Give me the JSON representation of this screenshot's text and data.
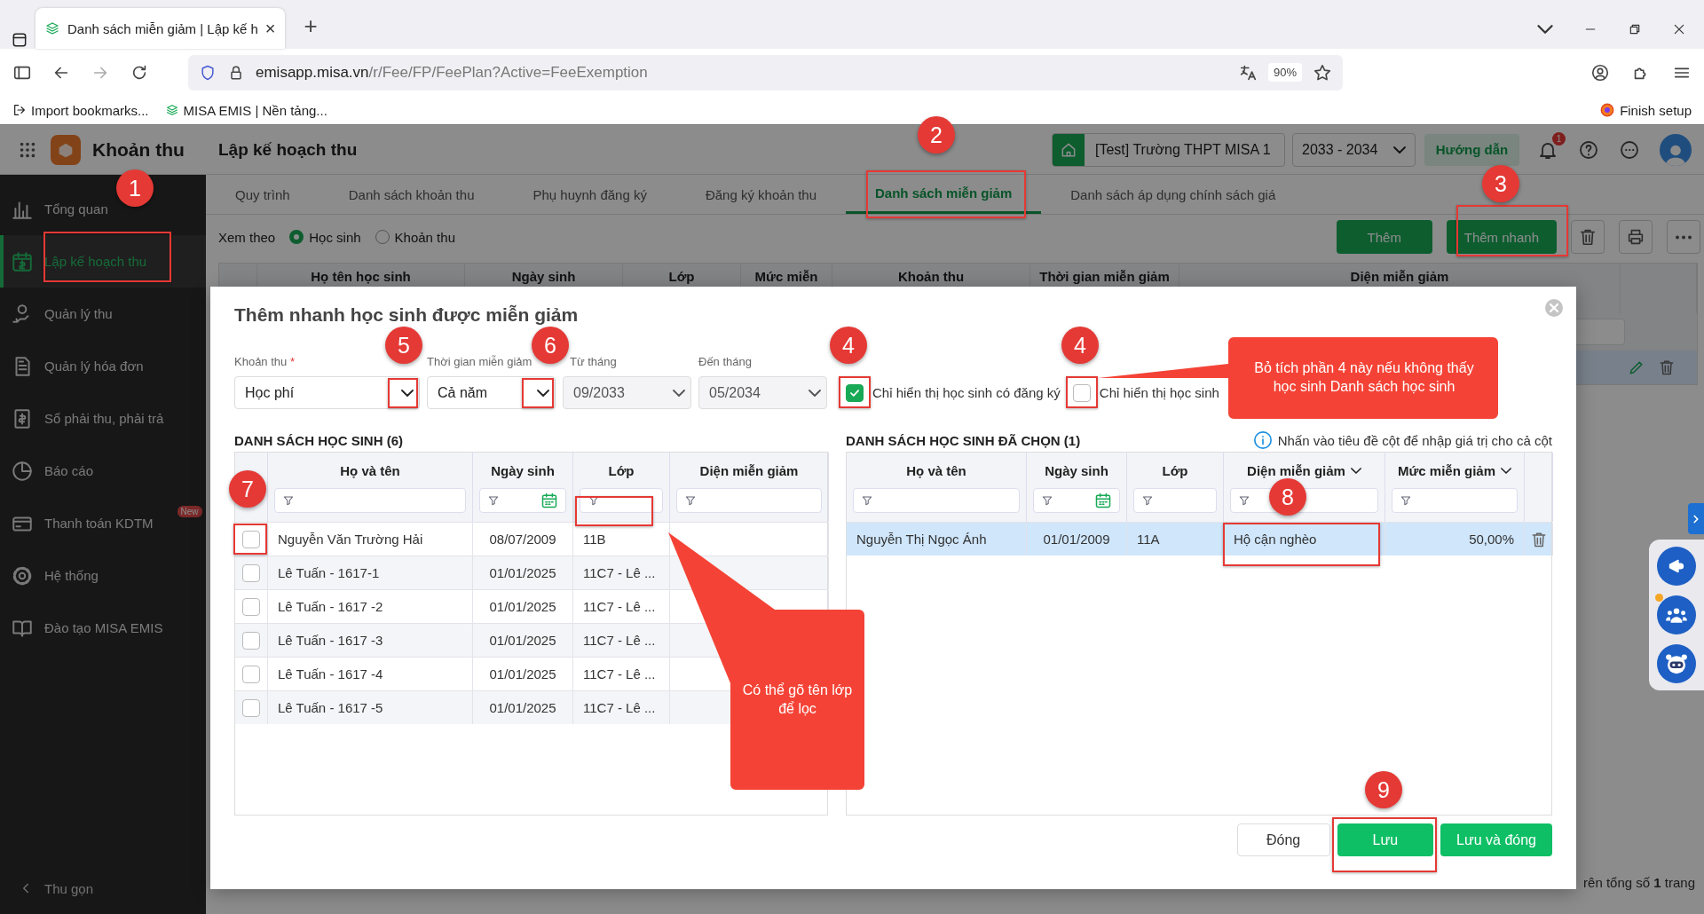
{
  "browser": {
    "tab_title": "Danh sách miễn giảm | Lập kế h",
    "tab_close": "×",
    "new_tab": "+",
    "url_host": "emisapp.misa.vn",
    "url_path": "/r/Fee/FP/FeePlan?Active=FeeExemption",
    "zoom": "90%",
    "bookmarks": [
      {
        "label": "Import bookmarks..."
      },
      {
        "label": "MISA EMIS | Nền tảng..."
      }
    ],
    "finish_setup": "Finish setup"
  },
  "app_header": {
    "app_name": "Khoản thu",
    "page_title": "Lập kế hoạch thu",
    "school": "[Test] Trường THPT MISA 1",
    "year": "2033 - 2034",
    "guide_button": "Hướng dẫn",
    "notification_count": "1"
  },
  "sidebar": {
    "items": [
      {
        "label": "Tổng quan",
        "selected": false
      },
      {
        "label": "Lập kế hoạch thu",
        "selected": true
      },
      {
        "label": "Quản lý thu",
        "selected": false
      },
      {
        "label": "Quản lý hóa đơn",
        "selected": false
      },
      {
        "label": "Sổ phải thu, phải trả",
        "selected": false
      },
      {
        "label": "Báo cáo",
        "selected": false
      },
      {
        "label": "Thanh toán KDTM",
        "selected": false,
        "badge": "New"
      },
      {
        "label": "Hệ thống",
        "selected": false
      },
      {
        "label": "Đào tạo MISA EMIS",
        "selected": false
      }
    ],
    "collapse": "Thu gọn"
  },
  "tabs": [
    {
      "label": "Quy trình",
      "selected": false
    },
    {
      "label": "Danh sách khoản thu",
      "selected": false
    },
    {
      "label": "Phụ huynh đăng ký",
      "selected": false
    },
    {
      "label": "Đăng ký khoản thu",
      "selected": false
    },
    {
      "label": "Danh sách miễn giảm",
      "selected": true
    },
    {
      "label": "Danh sách áp dụng chính sách giá",
      "selected": false
    }
  ],
  "view_by": {
    "label": "Xem theo",
    "options": [
      {
        "label": "Học sinh",
        "selected": true
      },
      {
        "label": "Khoản thu",
        "selected": false
      }
    ]
  },
  "toolbar_buttons": [
    "Thêm",
    "Thêm nhanh"
  ],
  "background_table": {
    "columns": [
      "Họ tên học sinh",
      "Ngày sinh",
      "Lớp",
      "Mức miễn",
      "Khoản thu",
      "Thời gian miễn giảm",
      "Diện miễn giảm"
    ],
    "row_selected": true
  },
  "page_footer": "rên tổng số **1** trang",
  "dialog": {
    "title": "Thêm nhanh học sinh được miễn giảm",
    "fields": [
      {
        "label": "Khoản thu",
        "required_mark": "*",
        "value": "Học phí",
        "disabled": false
      },
      {
        "label": "Thời gian miễn giảm",
        "value": "Cả năm",
        "disabled": false
      },
      {
        "label": "Từ tháng",
        "value": "09/2033",
        "disabled": true
      },
      {
        "label": "Đến tháng",
        "value": "05/2034",
        "disabled": true
      }
    ],
    "filters": [
      {
        "label": "Chỉ hiển thị học sinh có đăng ký",
        "checked": true
      },
      {
        "label": "Chỉ hiển thị học sinh",
        "checked": false
      }
    ],
    "students": {
      "title": "DANH SÁCH HỌC SINH (6)",
      "columns": [
        {
          "label": "Họ và tên",
          "kind": "text"
        },
        {
          "label": "Ngày sinh",
          "kind": "date"
        },
        {
          "label": "Lớp",
          "kind": "text"
        },
        {
          "label": "Diện miễn giảm",
          "kind": "text"
        }
      ],
      "rows": [
        {
          "name": "Nguyễn Văn Trường Hải",
          "dob": "08/07/2009",
          "class": "11B",
          "checked": false
        },
        {
          "name": "Lê Tuấn - 1617-1",
          "dob": "01/01/2025",
          "class": "11C7 - Lê ...",
          "checked": false
        },
        {
          "name": "Lê Tuấn - 1617 -2",
          "dob": "01/01/2025",
          "class": "11C7 - Lê ...",
          "checked": false
        },
        {
          "name": "Lê Tuấn - 1617 -3",
          "dob": "01/01/2025",
          "class": "11C7 - Lê ...",
          "checked": false
        },
        {
          "name": "Lê Tuấn - 1617 -4",
          "dob": "01/01/2025",
          "class": "11C7 - Lê ...",
          "checked": false
        },
        {
          "name": "Lê Tuấn - 1617 -5",
          "dob": "01/01/2025",
          "class": "11C7 - Lê ...",
          "checked": false
        }
      ]
    },
    "selected_students": {
      "title": "DANH SÁCH HỌC SINH ĐÃ CHỌN (1)",
      "hint": "Nhấn vào tiêu đề cột để nhập giá trị cho cả cột",
      "columns": [
        {
          "label": "Họ và tên",
          "kind": "text",
          "has_menu": false
        },
        {
          "label": "Ngày sinh",
          "kind": "date",
          "has_menu": false
        },
        {
          "label": "Lớp",
          "kind": "text",
          "has_menu": false
        },
        {
          "label": "Diện miễn giảm",
          "kind": "text",
          "has_menu": true
        },
        {
          "label": "Mức miễn giảm",
          "kind": "text",
          "has_menu": true
        }
      ],
      "rows": [
        {
          "name": "Nguyễn Thị Ngọc Ánh",
          "dob": "01/01/2009",
          "class": "11A",
          "category": "Hộ cận nghèo",
          "rate": "50,00%",
          "selected": true
        }
      ]
    },
    "buttons": [
      {
        "label": "Đóng",
        "kind": "secondary"
      },
      {
        "label": "Lưu",
        "kind": "primary"
      },
      {
        "label": "Lưu và đóng",
        "kind": "primary"
      }
    ]
  },
  "annotations": {
    "markers": [
      {
        "label": "2"
      },
      {
        "label": "1"
      },
      {
        "label": "3"
      },
      {
        "label": "5"
      },
      {
        "label": "6"
      },
      {
        "label": "4"
      },
      {
        "label": "4"
      },
      {
        "label": "7"
      },
      {
        "label": "8"
      },
      {
        "label": "9"
      }
    ],
    "callouts": [
      {
        "text": "Bỏ tích phần 4 này nếu không thấy học sinh Danh sách học sinh"
      },
      {
        "text": "Có thể gõ tên lớp để lọc"
      }
    ]
  }
}
